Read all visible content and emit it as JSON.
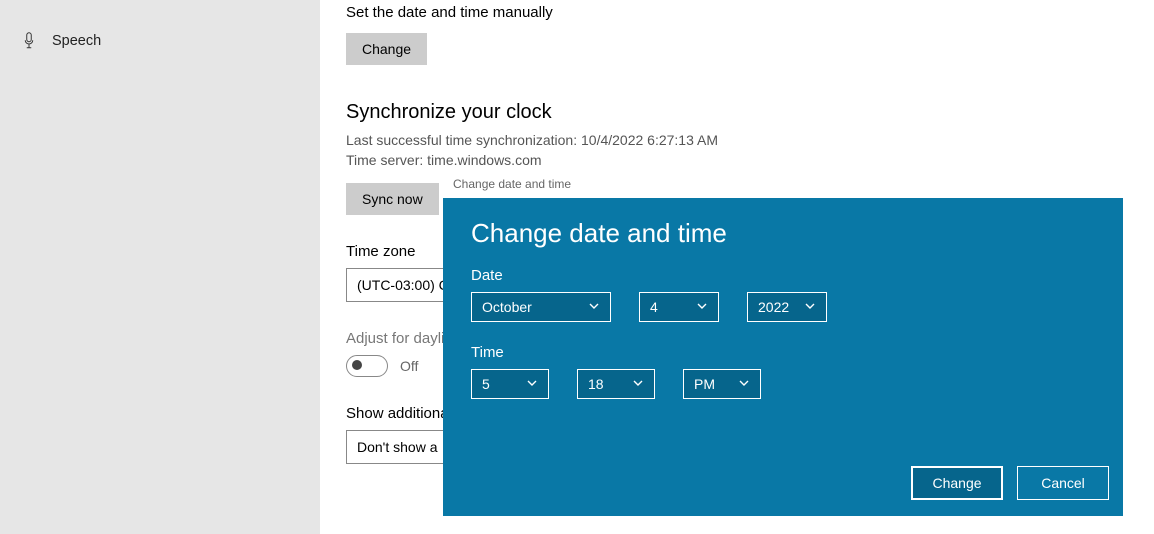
{
  "sidebar": {
    "items": [
      {
        "label": "Speech"
      }
    ]
  },
  "main": {
    "set_date_time_label": "Set the date and time manually",
    "change_btn": "Change",
    "sync_heading": "Synchronize your clock",
    "sync_info_line1": "Last successful time synchronization: 10/4/2022 6:27:13 AM",
    "sync_info_line2": "Time server: time.windows.com",
    "sync_now_btn": "Sync now",
    "tz_heading": "Time zone",
    "tz_value": "(UTC-03:00) C",
    "dst_label": "Adjust for dayli",
    "dst_state": "Off",
    "additional_heading": "Show additiona",
    "additional_value": "Don't show a"
  },
  "dialog": {
    "titlebar": "Change date and time",
    "heading": "Change date and time",
    "date_label": "Date",
    "month": "October",
    "day": "4",
    "year": "2022",
    "time_label": "Time",
    "hour": "5",
    "minute": "18",
    "ampm": "PM",
    "primary_btn": "Change",
    "secondary_btn": "Cancel"
  }
}
